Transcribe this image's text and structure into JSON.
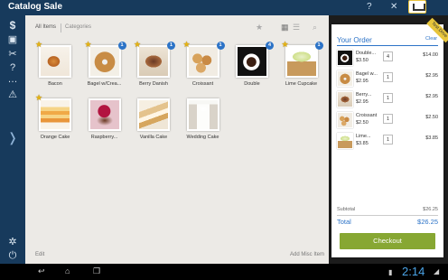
{
  "app": {
    "title": "Catalog Sale",
    "top_icons": [
      "question-icon",
      "close-icon",
      "cart-icon"
    ]
  },
  "sidebar": {
    "items": [
      {
        "icon": "dollar-icon",
        "glyph": "$"
      },
      {
        "icon": "save-icon",
        "glyph": "▣"
      },
      {
        "icon": "tools-icon",
        "glyph": "✂"
      },
      {
        "icon": "help-icon",
        "glyph": "?"
      },
      {
        "icon": "menu-icon",
        "glyph": "…"
      },
      {
        "icon": "warning-icon",
        "glyph": "⚠"
      },
      {
        "icon": "expand-icon",
        "glyph": "❭"
      },
      {
        "icon": "settings-icon",
        "glyph": "✲"
      },
      {
        "icon": "logout-icon",
        "glyph": "⏻"
      }
    ]
  },
  "toolbar": {
    "tab_all": "All Items",
    "tab_categories": "Categories",
    "icons": [
      "star-icon",
      "grid-icon",
      "list-icon",
      "search-icon"
    ]
  },
  "items": [
    {
      "name": "Bacon",
      "starred": true,
      "badge": "",
      "art": "bacon"
    },
    {
      "name": "Bagel w/Crea...",
      "starred": true,
      "badge": "1",
      "art": "bagel"
    },
    {
      "name": "Berry Danish",
      "starred": true,
      "badge": "1",
      "art": "berry"
    },
    {
      "name": "Croissant",
      "starred": true,
      "badge": "1",
      "art": "croissant"
    },
    {
      "name": "Double",
      "starred": false,
      "badge": "4",
      "art": "double"
    },
    {
      "name": "Lime Cupcake",
      "starred": true,
      "badge": "1",
      "art": "lime"
    },
    {
      "name": "Orange Cake",
      "starred": true,
      "badge": "",
      "art": "orange"
    },
    {
      "name": "Raspberry...",
      "starred": false,
      "badge": "",
      "art": "rasp"
    },
    {
      "name": "Vanilla Cake",
      "starred": false,
      "badge": "",
      "art": "vanilla"
    },
    {
      "name": "Wedding Cake",
      "starred": false,
      "badge": "",
      "art": "wedding"
    }
  ],
  "footer": {
    "edit": "Edit",
    "add_misc": "Add Misc Item"
  },
  "order": {
    "title": "Your Order",
    "clear": "Clear",
    "ribbon": "Test Drive",
    "lines": [
      {
        "name": "Double...",
        "price": "$3.50",
        "qty": "4",
        "total": "$14.00",
        "art": "double"
      },
      {
        "name": "Bagel w...",
        "price": "$2.95",
        "qty": "1",
        "total": "$2.95",
        "art": "bagel"
      },
      {
        "name": "Berry...",
        "price": "$2.95",
        "qty": "1",
        "total": "$2.95",
        "art": "berry"
      },
      {
        "name": "Croissant",
        "price": "$2.50",
        "qty": "1",
        "total": "$2.50",
        "art": "croissant"
      },
      {
        "name": "Lime...",
        "price": "$3.85",
        "qty": "1",
        "total": "$3.85",
        "art": "lime"
      }
    ],
    "subtotal_label": "Subtotal",
    "subtotal_value": "$26.25",
    "total_label": "Total",
    "total_value": "$26.25",
    "checkout": "Checkout"
  },
  "navbar": {
    "time": "2:14",
    "icons": [
      "back-icon",
      "home-icon",
      "recent-apps-icon",
      "battery-icon",
      "wifi-icon"
    ]
  },
  "colors": {
    "sidebar_bg": "#173a5c",
    "accent": "#2c73c7",
    "checkout": "#87a733",
    "ribbon": "#e7c53b",
    "star": "#e5b313"
  }
}
